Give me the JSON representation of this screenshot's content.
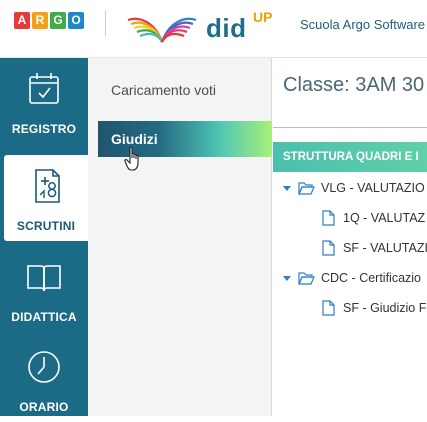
{
  "header": {
    "argo_letters": [
      "A",
      "R",
      "G",
      "O"
    ],
    "argo_colors": [
      "#e63a36",
      "#f6a01a",
      "#3fae49",
      "#1e88c9"
    ],
    "app_name": "did",
    "app_superscript": "UP",
    "school": "Scuola Argo Software"
  },
  "rail": {
    "items": [
      {
        "label": "REGISTRO",
        "icon": "calendar-check-icon"
      },
      {
        "label": "SCRUTINI",
        "icon": "scrutini-icon",
        "active": true
      },
      {
        "label": "DIDATTICA",
        "icon": "book-icon"
      },
      {
        "label": "ORARIO",
        "icon": "clock-icon"
      }
    ]
  },
  "submenu": {
    "items": [
      {
        "label": "Caricamento voti"
      },
      {
        "label": "Giudizi",
        "active": true
      }
    ]
  },
  "main": {
    "title": "Classe: 3AM 30",
    "tree_header": "STRUTTURA QUADRI E I",
    "tree": [
      {
        "type": "folder",
        "label": "VLG - VALUTAZIO"
      },
      {
        "type": "file",
        "label": "1Q - VALUTAZ"
      },
      {
        "type": "file",
        "label": "SF - VALUTAZI"
      },
      {
        "type": "folder",
        "label": "CDC - Certificazio"
      },
      {
        "type": "file",
        "label": "SF - Giudizio F"
      }
    ]
  },
  "colors": {
    "rail": "#1b6a86",
    "tree_header": "#4cbfae",
    "icon_blue": "#2f7fc1"
  }
}
